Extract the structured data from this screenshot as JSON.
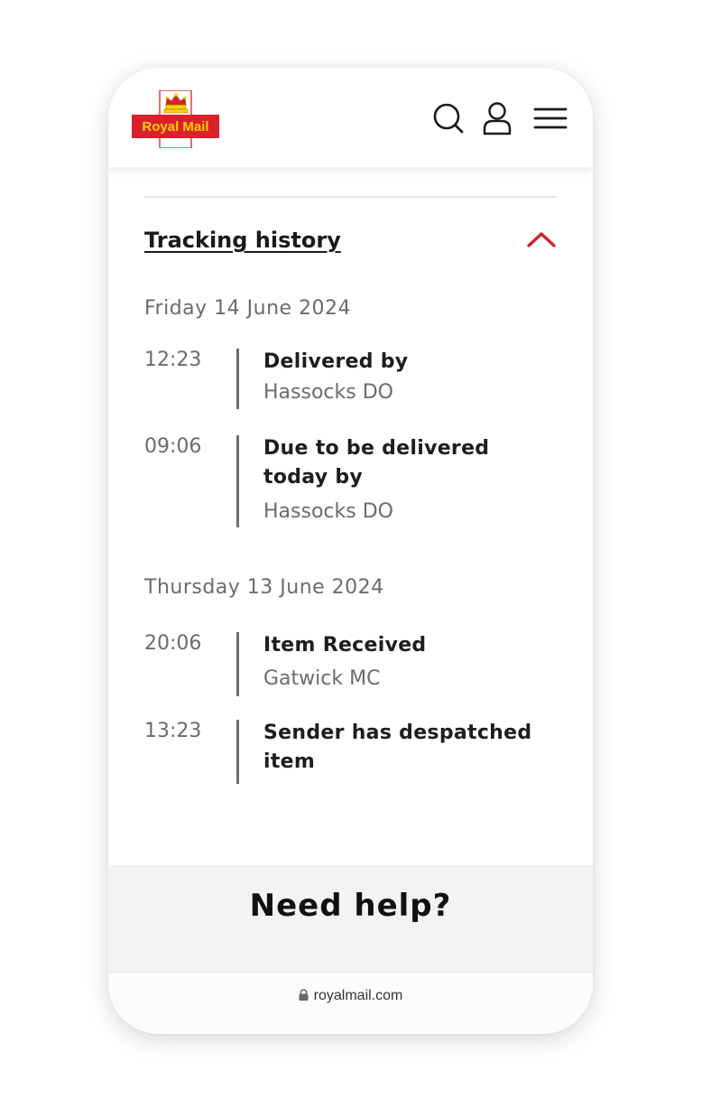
{
  "brand": {
    "name": "Royal Mail",
    "colors": {
      "red": "#da202a",
      "yellow": "#ffd100",
      "accent": "#d4212a"
    }
  },
  "header": {
    "icons": [
      "search-icon",
      "account-icon",
      "menu-icon"
    ]
  },
  "tracking": {
    "title": "Tracking history",
    "days": [
      {
        "date": "Friday 14 June 2024",
        "events": [
          {
            "time": "12:23",
            "status": "Delivered by",
            "location": "Hassocks DO"
          },
          {
            "time": "09:06",
            "status": "Due to be delivered today by",
            "location": "Hassocks DO"
          }
        ]
      },
      {
        "date": "Thursday 13 June 2024",
        "events": [
          {
            "time": "20:06",
            "status": "Item Received",
            "location": "Gatwick MC"
          },
          {
            "time": "13:23",
            "status": "Sender has despatched item",
            "location": ""
          }
        ]
      }
    ]
  },
  "help": {
    "title": "Need help?"
  },
  "browser": {
    "url": "royalmail.com"
  }
}
